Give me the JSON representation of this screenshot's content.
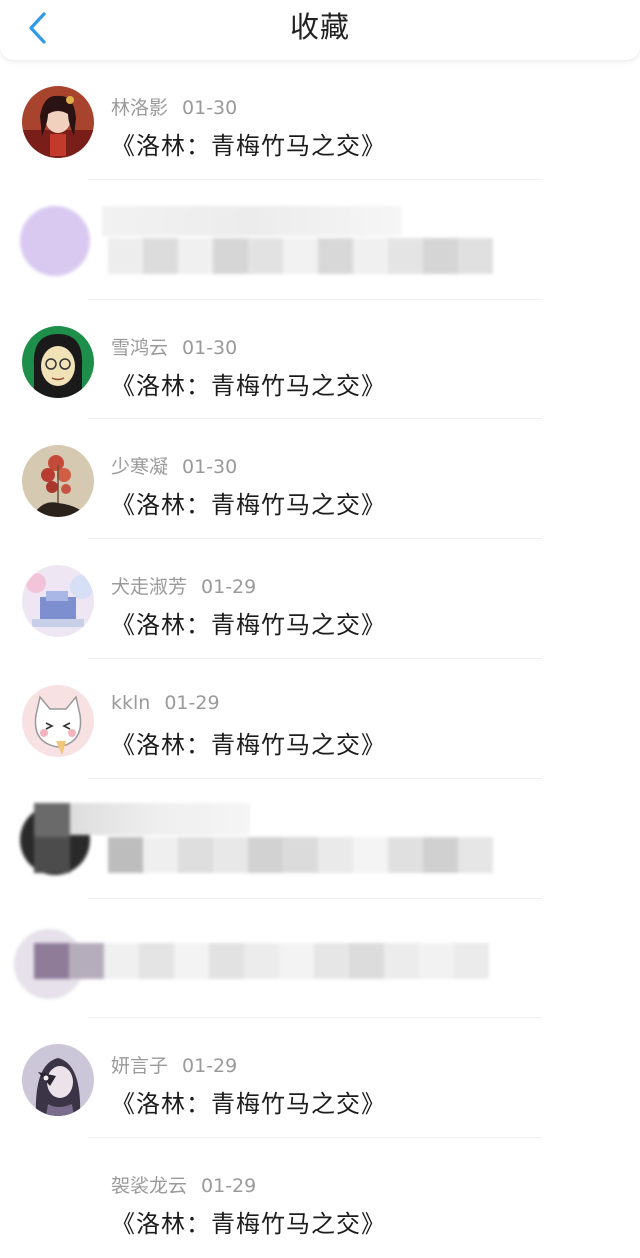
{
  "header": {
    "title": "收藏"
  },
  "items": [
    {
      "name": "林洛影",
      "date": "01-30",
      "work": "《洛林：青梅竹马之交》"
    },
    {
      "name": "",
      "date": "",
      "work": "",
      "hidden": true
    },
    {
      "name": "雪鸿云",
      "date": "01-30",
      "work": "《洛林：青梅竹马之交》"
    },
    {
      "name": "少寒凝",
      "date": "01-30",
      "work": "《洛林：青梅竹马之交》"
    },
    {
      "name": "犬走淑芳",
      "date": "01-29",
      "work": "《洛林：青梅竹马之交》"
    },
    {
      "name": "kkln",
      "date": "01-29",
      "work": "《洛林：青梅竹马之交》"
    },
    {
      "name": "",
      "date": "",
      "work": "",
      "hidden": true
    },
    {
      "name": "",
      "date": "",
      "work": "",
      "hidden": true
    },
    {
      "name": "妍言子",
      "date": "01-29",
      "work": "《洛林：青梅竹马之交》"
    },
    {
      "name": "袈裟龙云",
      "date": "01-29",
      "work": "《洛林：青梅竹马之交》"
    }
  ],
  "colors": {
    "accent": "#2f9ae8"
  }
}
